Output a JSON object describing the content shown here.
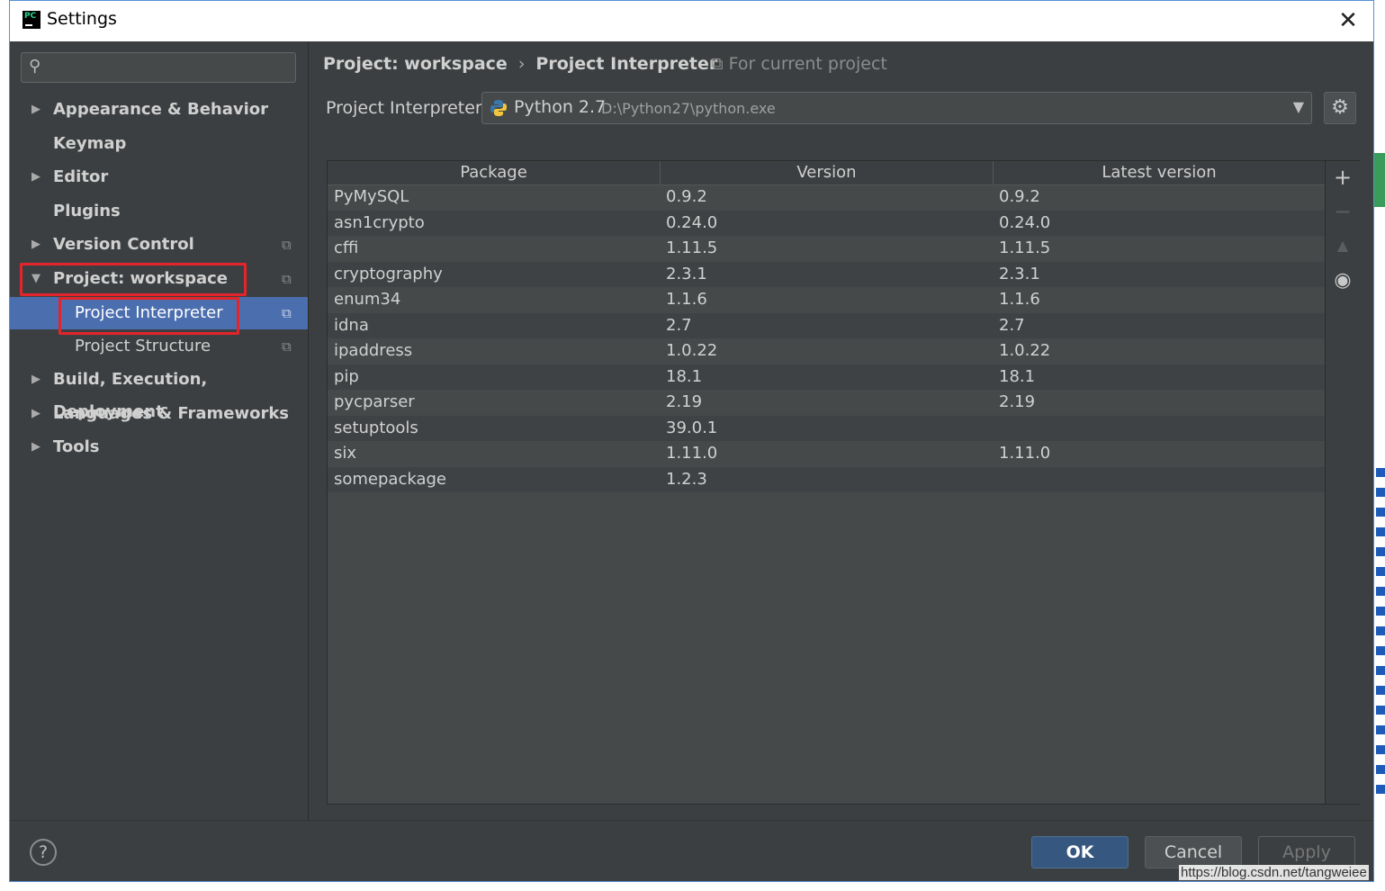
{
  "window": {
    "title": "Settings",
    "app_icon_text": "PC"
  },
  "sidebar": {
    "search": {
      "placeholder": ""
    },
    "items": [
      {
        "label": "Appearance & Behavior",
        "arrow": "▶",
        "copy": ""
      },
      {
        "label": "Keymap",
        "arrow": "",
        "copy": ""
      },
      {
        "label": "Editor",
        "arrow": "▶",
        "copy": ""
      },
      {
        "label": "Plugins",
        "arrow": "",
        "copy": ""
      },
      {
        "label": "Version Control",
        "arrow": "▶",
        "copy": "⧉"
      },
      {
        "label": "Project: workspace",
        "arrow": "▼",
        "copy": "⧉"
      },
      {
        "label": "Project Interpreter",
        "arrow": "",
        "copy": "⧉"
      },
      {
        "label": "Project Structure",
        "arrow": "",
        "copy": "⧉"
      },
      {
        "label": "Build, Execution, Deployment",
        "arrow": "▶",
        "copy": ""
      },
      {
        "label": "Languages & Frameworks",
        "arrow": "▶",
        "copy": ""
      },
      {
        "label": "Tools",
        "arrow": "▶",
        "copy": ""
      }
    ]
  },
  "content": {
    "breadcrumb": {
      "parent": "Project: workspace",
      "separator": "›",
      "current": "Project Interpreter"
    },
    "for_current_project": "⧉ For current project",
    "interpreter": {
      "label": "Project Interpreter:",
      "name": "Python 2.7",
      "path": "D:\\Python27\\python.exe"
    },
    "table": {
      "headers": [
        "Package",
        "Version",
        "Latest version"
      ],
      "rows": [
        [
          "PyMySQL",
          "0.9.2",
          "0.9.2"
        ],
        [
          "asn1crypto",
          "0.24.0",
          "0.24.0"
        ],
        [
          "cffi",
          "1.11.5",
          "1.11.5"
        ],
        [
          "cryptography",
          "2.3.1",
          "2.3.1"
        ],
        [
          "enum34",
          "1.1.6",
          "1.1.6"
        ],
        [
          "idna",
          "2.7",
          "2.7"
        ],
        [
          "ipaddress",
          "1.0.22",
          "1.0.22"
        ],
        [
          "pip",
          "18.1",
          "18.1"
        ],
        [
          "pycparser",
          "2.19",
          "2.19"
        ],
        [
          "setuptools",
          "39.0.1",
          ""
        ],
        [
          "six",
          "1.11.0",
          "1.11.0"
        ],
        [
          "somepackage",
          "1.2.3",
          ""
        ]
      ]
    },
    "tools": {
      "add": "+",
      "remove": "−",
      "upgrade": "▲",
      "show": "◉"
    }
  },
  "footer": {
    "help": "?",
    "ok": "OK",
    "cancel": "Cancel",
    "apply": "Apply"
  },
  "watermark": "https://blog.csdn.net/tangweiee",
  "colors": {
    "selection": "#4b6eaf",
    "highlight_box": "#e3252b",
    "ok_button": "#365880",
    "background": "#3c3f41"
  }
}
